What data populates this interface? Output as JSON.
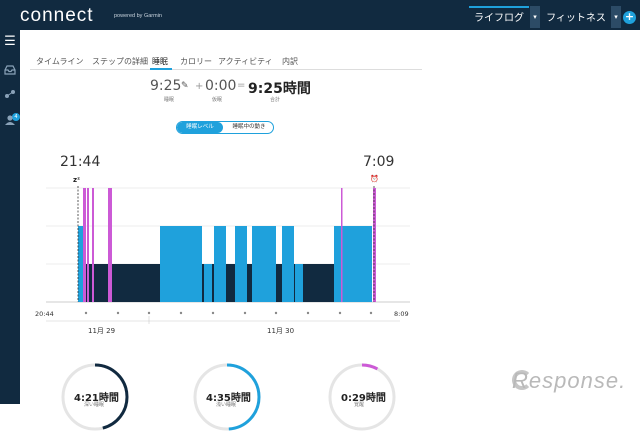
{
  "app": {
    "logo": "connect",
    "powered": "powered by Garmin"
  },
  "topnav": {
    "lifelog": "ライフログ",
    "fitness": "フィットネス",
    "dropdown": "▾",
    "plus": "+"
  },
  "sidebar": {
    "menu_icon": "☰",
    "badge": "4"
  },
  "tabs": [
    "タイムライン",
    "ステップの詳細",
    "睡眠",
    "カロリー",
    "アクティビティ",
    "内訳"
  ],
  "summary": {
    "sleep": "9:25",
    "sleep_label": "睡眠",
    "edit_icon": "✎",
    "plus_op": "+",
    "nap": "0:00",
    "nap_label": "仮眠",
    "equals_op": "=",
    "total": "9:25時間",
    "total_label": "合計"
  },
  "toggle": {
    "levels": "睡眠レベル",
    "movement": "睡眠中の動き"
  },
  "times": {
    "start": "21:44",
    "end": "7:09"
  },
  "icons": {
    "zz": "zᶻ",
    "alarm": "⏰"
  },
  "chart_data": {
    "type": "area",
    "levels": [
      "deep",
      "light",
      "awake"
    ],
    "x_start": "20:44",
    "x_end": "8:09",
    "dates": [
      "11月 29",
      "11月 30"
    ],
    "colors": {
      "deep": "#112a40",
      "light": "#1fa1dc",
      "awake": "#cc5ad6"
    }
  },
  "rings": [
    {
      "value": "4:21時間",
      "label": "深い睡眠",
      "color": "#112a40",
      "fraction": 0.46
    },
    {
      "value": "4:35時間",
      "label": "浅い睡眠",
      "color": "#1fa1dc",
      "fraction": 0.49
    },
    {
      "value": "0:29時間",
      "label": "覚醒",
      "color": "#cc5ad6",
      "fraction": 0.08
    }
  ],
  "watermark": "Response."
}
